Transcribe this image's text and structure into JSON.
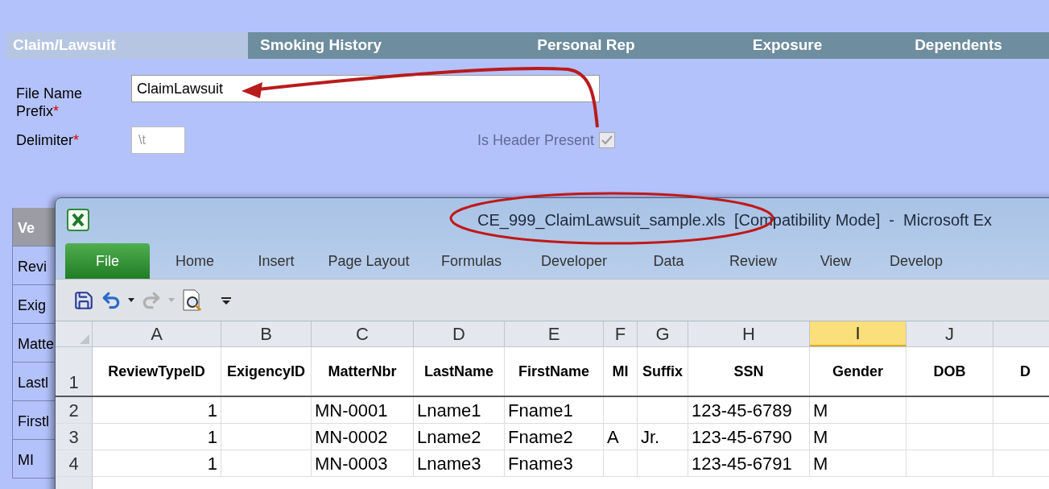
{
  "tabs": [
    {
      "label": "Claim/Lawsuit",
      "selected": true
    },
    {
      "label": "Smoking History",
      "selected": false
    },
    {
      "label": "Personal Rep",
      "selected": false
    },
    {
      "label": "Exposure",
      "selected": false
    },
    {
      "label": "Dependents",
      "selected": false
    }
  ],
  "form": {
    "file_name_prefix": {
      "label": "File Name Prefix",
      "required_mark": "*",
      "value": "ClaimLawsuit"
    },
    "delimiter": {
      "label": "Delimiter",
      "required_mark": "*",
      "value": "\\t"
    },
    "header_present": {
      "label": "Is Header Present",
      "checked": true,
      "disabled": true
    }
  },
  "background_table": [
    {
      "text": "Ve",
      "kind": "header"
    },
    {
      "text": "Revi",
      "kind": "cell"
    },
    {
      "text": "Exig",
      "kind": "cell"
    },
    {
      "text": "Matte",
      "kind": "cell"
    },
    {
      "text": "Lastl",
      "kind": "cell"
    },
    {
      "text": "Firstl",
      "kind": "cell"
    },
    {
      "text": "MI",
      "kind": "cell"
    }
  ],
  "excel": {
    "title": "CE_999_ClaimLawsuit_sample.xls  [Compatibility Mode]  -  Microsoft Ex",
    "ribbon_tabs": [
      {
        "label": "File",
        "selected": true
      },
      {
        "label": "Home",
        "selected": false
      },
      {
        "label": "Insert",
        "selected": false
      },
      {
        "label": "Page Layout",
        "selected": false
      },
      {
        "label": "Formulas",
        "selected": false
      },
      {
        "label": "Developer",
        "selected": false
      },
      {
        "label": "Data",
        "selected": false
      },
      {
        "label": "Review",
        "selected": false
      },
      {
        "label": "View",
        "selected": false
      },
      {
        "label": "Develop",
        "selected": false
      }
    ],
    "columns": [
      {
        "letter": "A",
        "selected": false
      },
      {
        "letter": "B",
        "selected": false
      },
      {
        "letter": "C",
        "selected": false
      },
      {
        "letter": "D",
        "selected": false
      },
      {
        "letter": "E",
        "selected": false
      },
      {
        "letter": "F",
        "selected": false
      },
      {
        "letter": "G",
        "selected": false
      },
      {
        "letter": "H",
        "selected": false
      },
      {
        "letter": "I",
        "selected": true
      },
      {
        "letter": "J",
        "selected": false
      }
    ],
    "rows": [
      {
        "number": "1",
        "kind": "header",
        "cells": [
          "ReviewTypeID",
          "ExigencyID",
          "MatterNbr",
          "LastName",
          "FirstName",
          "MI",
          "Suffix",
          "SSN",
          "Gender",
          "DOB",
          "D"
        ]
      },
      {
        "number": "2",
        "kind": "data",
        "cells": [
          "1",
          "",
          "MN-0001",
          "Lname1",
          "Fname1",
          "",
          "",
          "123-45-6789",
          "M",
          "",
          ""
        ]
      },
      {
        "number": "3",
        "kind": "data",
        "cells": [
          "1",
          "",
          "MN-0002",
          "Lname2",
          "Fname2",
          "A",
          "Jr.",
          "123-45-6790",
          "M",
          "",
          ""
        ]
      },
      {
        "number": "4",
        "kind": "data",
        "cells": [
          "1",
          "",
          "MN-0003",
          "Lname3",
          "Fname3",
          "",
          "",
          "123-45-6791",
          "M",
          "",
          ""
        ]
      }
    ]
  }
}
